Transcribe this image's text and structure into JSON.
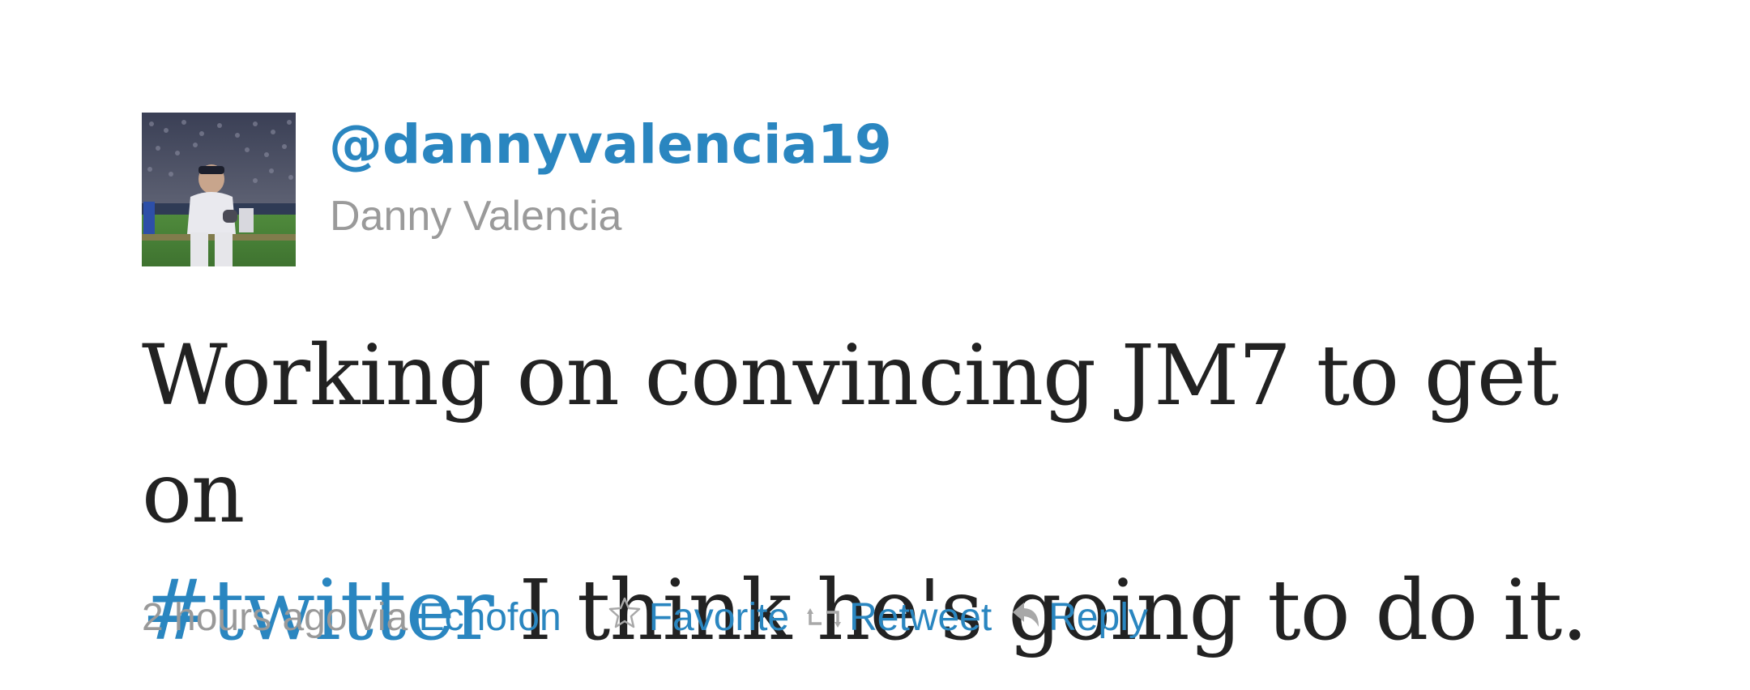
{
  "tweet": {
    "handle": "@dannyvalencia19",
    "display_name": "Danny Valencia",
    "text_before": "Working on convincing JM7 to get on",
    "hashtag": "#twitter",
    "text_after": " I think he's going to do it.",
    "timestamp": "2 hours ago",
    "via_label": " via ",
    "source": "Echofon"
  },
  "actions": {
    "favorite": "Favorite",
    "retweet": "Retweet",
    "reply": "Reply"
  },
  "colors": {
    "link": "#2a86c0",
    "muted": "#999999",
    "text": "#222222"
  },
  "icons": {
    "favorite": "star-icon",
    "retweet": "retweet-icon",
    "reply": "reply-arrow-icon"
  }
}
